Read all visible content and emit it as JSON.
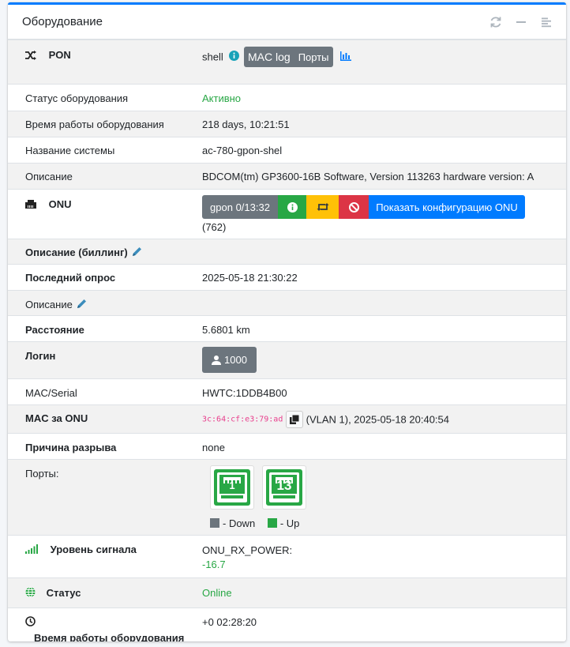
{
  "card": {
    "title": "Оборудование",
    "accent": "#007bff"
  },
  "tools": {
    "refresh": "refresh-icon",
    "collapse": "minus-icon",
    "menu": "list-icon"
  },
  "pon": {
    "label": "PON",
    "name": "shell",
    "mac_log": "MAC log",
    "ports": "Порты"
  },
  "rows": {
    "status_label": "Статус оборудования",
    "status_value": "Активно",
    "uptime_label": "Время работы оборудования",
    "uptime_value": "218 days, 10:21:51",
    "sysname_label": "Название системы",
    "sysname_value": "ac-780-gpon-shel",
    "descr_label": "Описание",
    "descr_value": "BDCOM(tm) GP3600-16B Software, Version 113263 hardware version: A"
  },
  "onu": {
    "label": "ONU",
    "iface": "gpon 0/13:32",
    "show_config": "Показать конфигурацию ONU",
    "id": "(762)"
  },
  "details": {
    "billing_descr_label": "Описание (биллинг)",
    "last_poll_label": "Последний опрос",
    "last_poll_value": "2025-05-18 21:30:22",
    "descr_label": "Описание",
    "distance_label": "Расстояние",
    "distance_value": "5.6801 km",
    "login_label": "Логин",
    "login_value": "1000",
    "mac_label": "MAC/Serial",
    "mac_value": "HWTC:1DDB4B00",
    "mac_behind_label": "MAC за ONU",
    "mac_behind_value": "3c:64:cf:e3:79:ad",
    "mac_behind_extra": "(VLAN 1), 2025-05-18 20:40:54",
    "reason_label": "Причина разрыва",
    "reason_value": "none",
    "ports_label": "Порты:",
    "port1": "1",
    "port2": "13",
    "legend_down": "- Down",
    "legend_up": "- Up",
    "signal_label": "Уровень сигнала",
    "signal_name": "ONU_RX_POWER:",
    "signal_value": "-16.7",
    "state_label": "Статус",
    "state_value": "Online",
    "onu_uptime_label": "Время работы оборудования",
    "onu_uptime_value": "+0 02:28:20"
  },
  "colors": {
    "green": "#28a745",
    "gray": "#6c757d",
    "blue": "#007bff",
    "red": "#dc3545",
    "yellow": "#ffc107"
  }
}
